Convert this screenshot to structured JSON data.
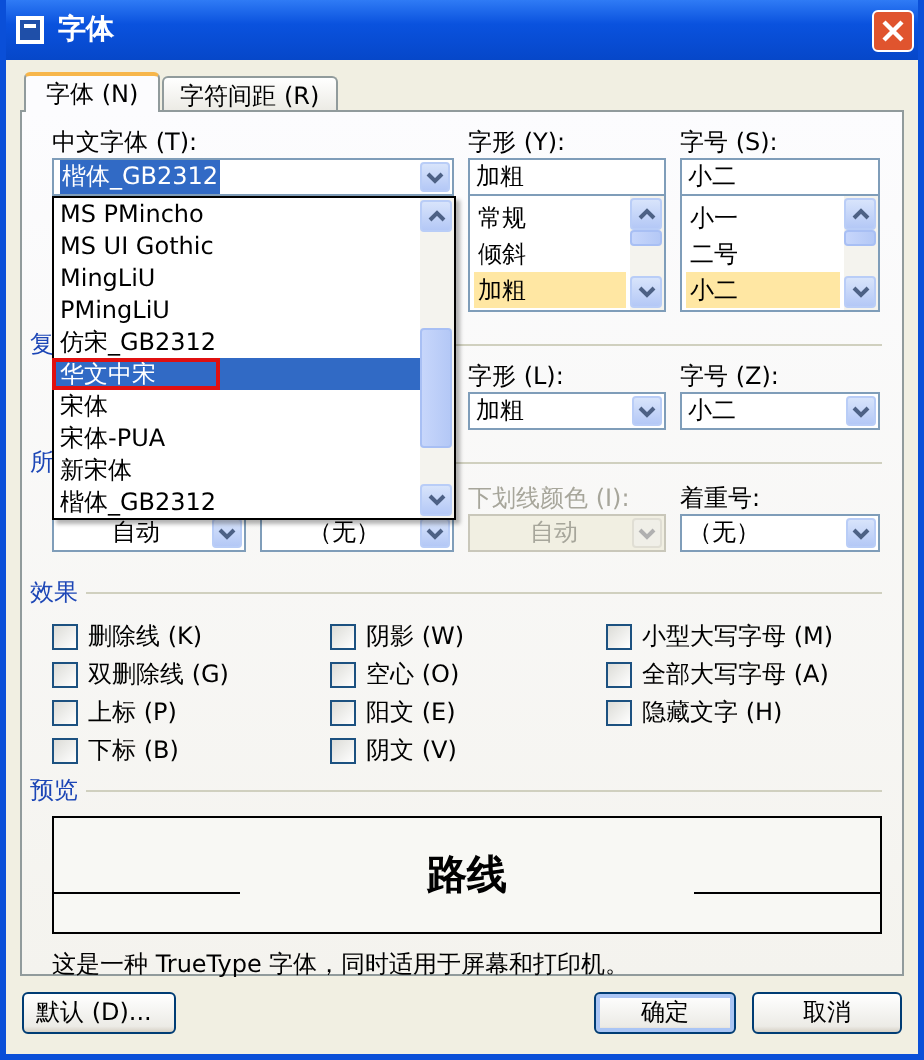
{
  "window": {
    "title": "字体"
  },
  "tabs": [
    {
      "label": "字体 (N)",
      "selected": true
    },
    {
      "label": "字符间距 (R)",
      "selected": false
    }
  ],
  "font_row": {
    "chinese_font": {
      "label": "中文字体 (T):",
      "value": "楷体_GB2312"
    },
    "style": {
      "label": "字形 (Y):",
      "value": "加粗",
      "options": [
        {
          "label": "常规",
          "selected": false
        },
        {
          "label": "倾斜",
          "selected": false
        },
        {
          "label": "加粗",
          "selected": true
        }
      ]
    },
    "size": {
      "label": "字号 (S):",
      "value": "小二",
      "options": [
        {
          "label": "小一",
          "selected": false
        },
        {
          "label": "二号",
          "selected": false
        },
        {
          "label": "小二",
          "selected": true
        }
      ]
    }
  },
  "font_dropdown": {
    "items": [
      {
        "label": "MS PMincho",
        "selected": false,
        "marked": false
      },
      {
        "label": "MS UI Gothic",
        "selected": false,
        "marked": false
      },
      {
        "label": "MingLiU",
        "selected": false,
        "marked": false
      },
      {
        "label": "PMingLiU",
        "selected": false,
        "marked": false
      },
      {
        "label": "仿宋_GB2312",
        "selected": false,
        "marked": false
      },
      {
        "label": "华文中宋",
        "selected": true,
        "marked": true
      },
      {
        "label": "宋体",
        "selected": false,
        "marked": false
      },
      {
        "label": "宋体-PUA",
        "selected": false,
        "marked": false
      },
      {
        "label": "新宋体",
        "selected": false,
        "marked": false
      },
      {
        "label": "楷体_GB2312",
        "selected": false,
        "marked": false
      }
    ]
  },
  "complex_script": {
    "heading": "复",
    "style": {
      "label": "字形 (L):",
      "value": "加粗"
    },
    "size": {
      "label": "字号 (Z):",
      "value": "小二"
    }
  },
  "all_text": {
    "heading": "所",
    "fields": [
      {
        "value": "自动",
        "disabled": false
      },
      {
        "value": "（无）",
        "disabled": false
      },
      {
        "label": "下划线颜色 (I):",
        "value": "自动",
        "disabled": true
      },
      {
        "label": "着重号:",
        "value": "（无）",
        "disabled": false
      }
    ]
  },
  "effects": {
    "heading": "效果",
    "options": [
      {
        "label": "删除线 (K)",
        "checked": false
      },
      {
        "label": "阴影 (W)",
        "checked": false
      },
      {
        "label": "小型大写字母 (M)",
        "checked": false
      },
      {
        "label": "双删除线 (G)",
        "checked": false
      },
      {
        "label": "空心 (O)",
        "checked": false
      },
      {
        "label": "全部大写字母 (A)",
        "checked": false
      },
      {
        "label": "上标 (P)",
        "checked": false
      },
      {
        "label": "阳文 (E)",
        "checked": false
      },
      {
        "label": "隐藏文字 (H)",
        "checked": false
      },
      {
        "label": "下标 (B)",
        "checked": false
      },
      {
        "label": "阴文 (V)",
        "checked": false
      }
    ]
  },
  "preview": {
    "heading": "预览",
    "sample": "路线",
    "note": "这是一种 TrueType 字体，同时适用于屏幕和打印机。"
  },
  "buttons": [
    {
      "label": "默认 (D)...",
      "kind": "default"
    },
    {
      "label": "确定",
      "kind": "ok"
    },
    {
      "label": "取消",
      "kind": "cancel"
    }
  ]
}
